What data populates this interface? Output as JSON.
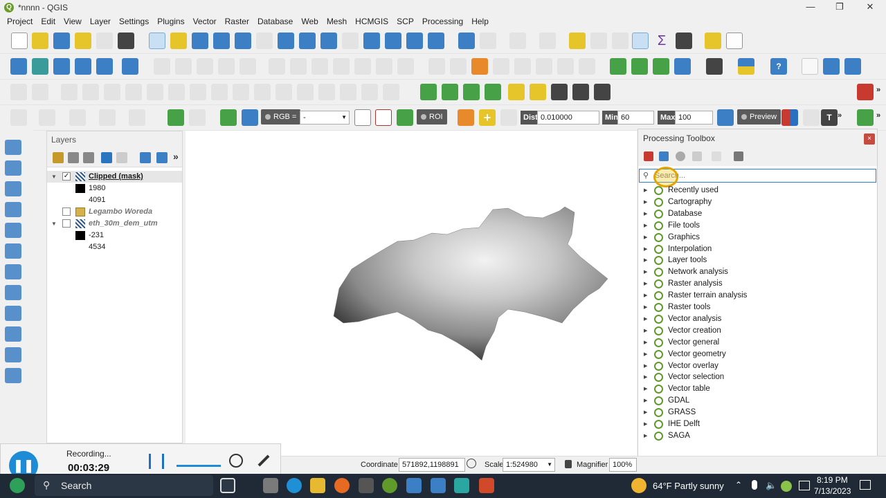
{
  "window": {
    "title": "*nnnn - QGIS",
    "app_letter": "Q"
  },
  "menu": [
    "Project",
    "Edit",
    "View",
    "Layer",
    "Settings",
    "Plugins",
    "Vector",
    "Raster",
    "Database",
    "Web",
    "Mesh",
    "HCMGIS",
    "SCP",
    "Processing",
    "Help"
  ],
  "toolbar4": {
    "rgb_label": "RGB =",
    "rgb_value": "-",
    "roi_label": "ROI",
    "dist_label": "Dist",
    "dist_value": "0.010000",
    "min_label": "Min",
    "min_value": "60",
    "max_label": "Max",
    "max_value": "100",
    "preview_label": "Preview"
  },
  "layers": {
    "title": "Layers",
    "items": [
      {
        "name": "Clipped (mask)",
        "checked": "✓"
      },
      {
        "value": "1980"
      },
      {
        "value": "4091"
      },
      {
        "name": "Legambo Woreda"
      },
      {
        "name": "eth_30m_dem_utm"
      },
      {
        "value": "-231"
      },
      {
        "value": "4534"
      }
    ]
  },
  "toolbox": {
    "title": "Processing Toolbox",
    "search_placeholder": "Search...",
    "items": [
      "Recently used",
      "Cartography",
      "Database",
      "File tools",
      "Graphics",
      "Interpolation",
      "Layer tools",
      "Network analysis",
      "Raster analysis",
      "Raster terrain analysis",
      "Raster tools",
      "Vector analysis",
      "Vector creation",
      "Vector general",
      "Vector geometry",
      "Vector overlay",
      "Vector selection",
      "Vector table",
      "GDAL",
      "GRASS",
      "IHE Delft",
      "SAGA"
    ]
  },
  "status": {
    "coordinate_label": "Coordinate",
    "coordinate_value": "571892,1198891",
    "scale_label": "Scale",
    "scale_value": "1:524980",
    "magnifier_label": "Magnifier",
    "magnifier_value": "100%"
  },
  "recording": {
    "label": "Recording...",
    "time": "00:03:29"
  },
  "taskbar": {
    "search_label": "Search",
    "weather": "64°F  Partly sunny",
    "time": "8:19 PM",
    "date": "7/13/2023"
  }
}
